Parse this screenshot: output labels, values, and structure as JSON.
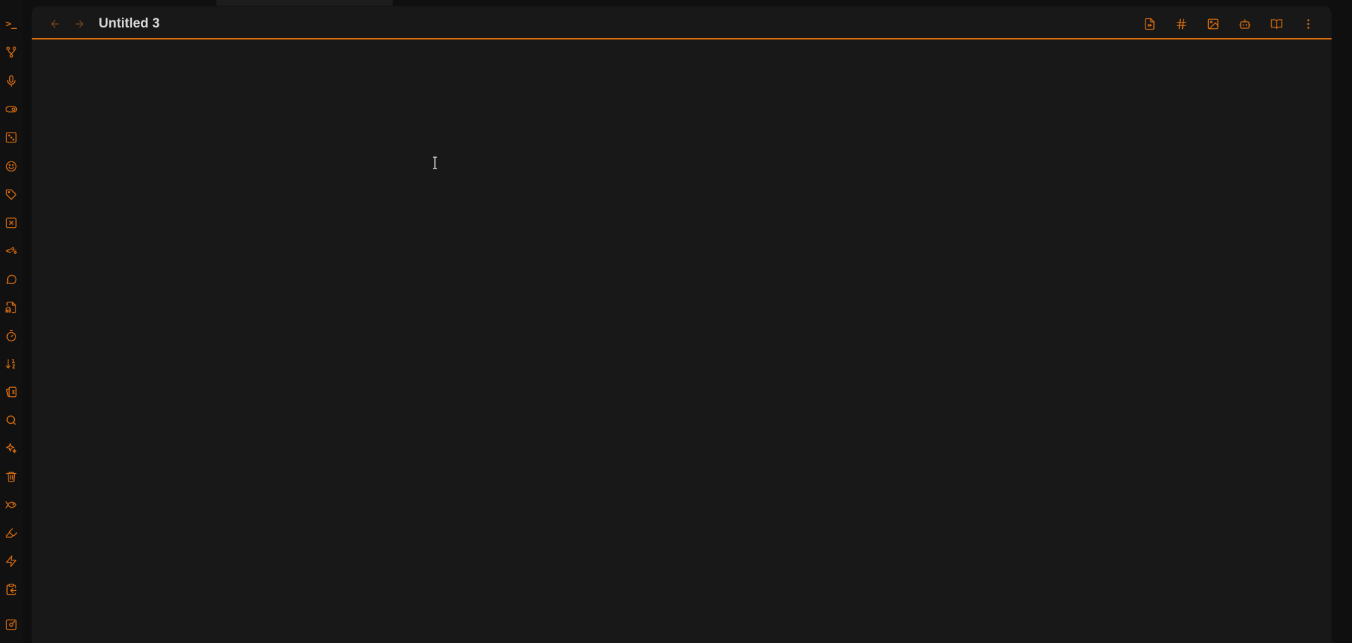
{
  "window": {
    "title": "Untitled 3"
  },
  "colors": {
    "accent": "#e06c0a",
    "icon": "#d96d0e",
    "pane_background": "#181818",
    "app_background": "#0f0f10",
    "title_text": "#d8d8d8"
  },
  "ribbon": {
    "items": [
      {
        "icon": "terminal-icon",
        "text": ">_"
      },
      {
        "icon": "git-branch-icon"
      },
      {
        "icon": "microphone-icon"
      },
      {
        "icon": "toggle-icon"
      },
      {
        "icon": "dice-icon"
      },
      {
        "icon": "smiley-icon"
      },
      {
        "icon": "tag-icon"
      },
      {
        "icon": "x-square-icon"
      },
      {
        "icon": "templater-icon",
        "text": "<%"
      },
      {
        "icon": "message-circle-icon"
      },
      {
        "icon": "file-audio-icon"
      },
      {
        "icon": "timer-icon"
      },
      {
        "icon": "sort-icon"
      },
      {
        "icon": "cards-icon"
      },
      {
        "icon": "search-icon"
      },
      {
        "icon": "sparkles-icon"
      },
      {
        "icon": "trash-icon"
      },
      {
        "icon": "fish-icon"
      },
      {
        "icon": "highlighter-icon"
      },
      {
        "icon": "zap-icon"
      },
      {
        "icon": "clipboard-export-icon"
      },
      {
        "icon": "vault-icon"
      }
    ]
  },
  "header": {
    "back_icon": "arrow-left-icon",
    "forward_icon": "arrow-right-icon",
    "actions": [
      {
        "icon": "file-link-icon"
      },
      {
        "icon": "hash-icon"
      },
      {
        "icon": "image-icon"
      },
      {
        "icon": "bot-icon"
      },
      {
        "icon": "book-open-icon"
      },
      {
        "icon": "more-vertical-icon"
      }
    ]
  },
  "editor": {
    "content": ""
  }
}
